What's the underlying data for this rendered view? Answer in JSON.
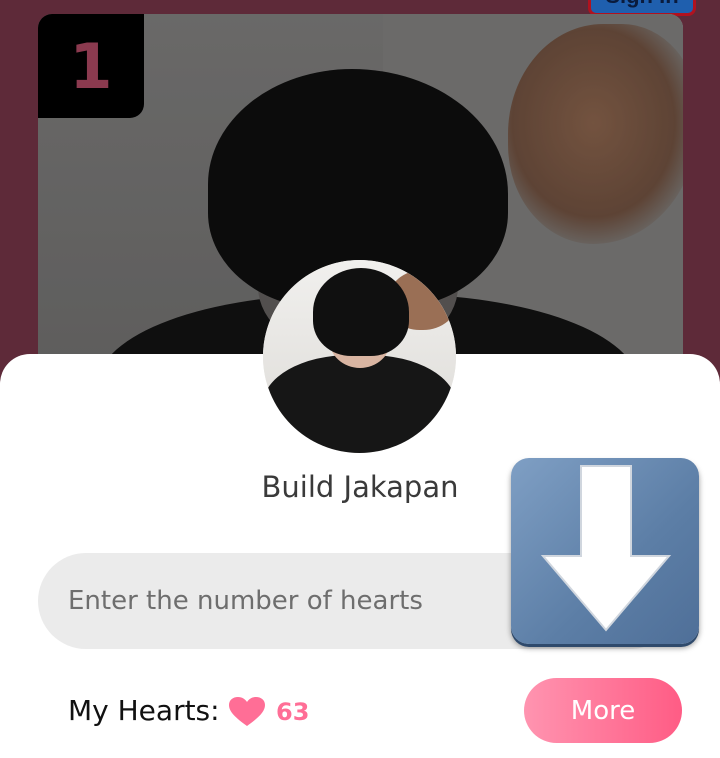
{
  "header": {
    "signin_label": "Sign In"
  },
  "card": {
    "rank": "1"
  },
  "profile": {
    "name": "Build Jakapan"
  },
  "vote": {
    "placeholder": "Enter the number of hearts"
  },
  "wallet": {
    "label": "My Hearts:",
    "count": "63",
    "more_label": "More"
  },
  "icons": {
    "heart": "heart-icon",
    "download": "download-arrow-icon"
  },
  "colors": {
    "accent_pink": "#ff6e96",
    "backdrop": "#5e2a39",
    "badge_text": "#8b3a4f"
  }
}
